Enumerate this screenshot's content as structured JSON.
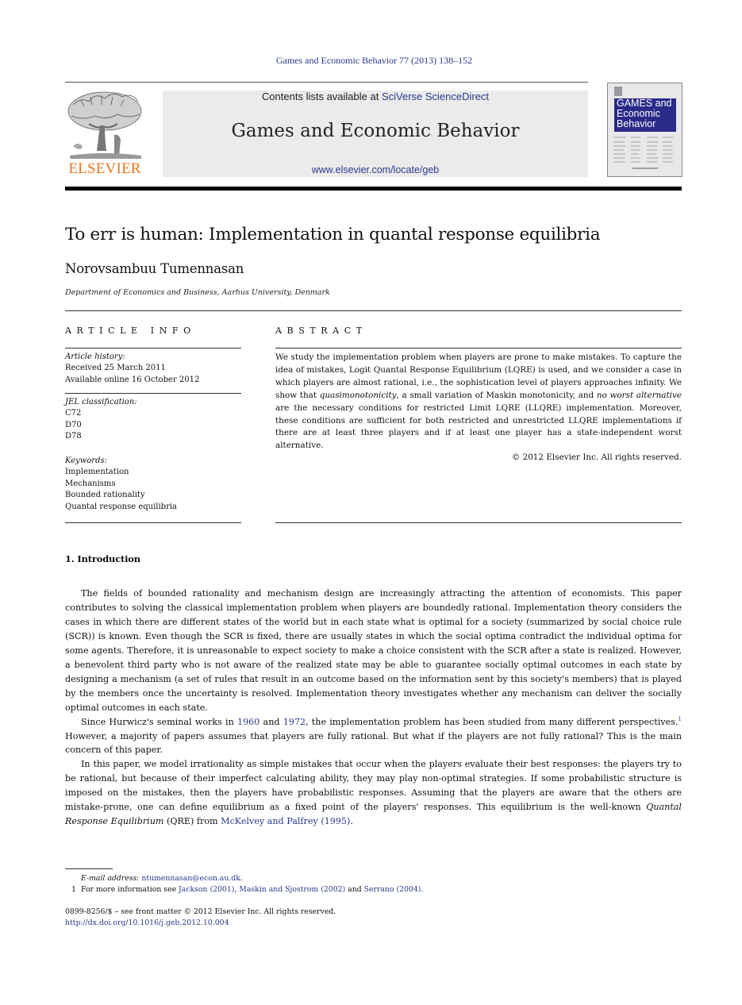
{
  "journal_ref": "Games and Economic Behavior 77 (2013) 138–152",
  "header": {
    "publisher_wordmark": "ELSEVIER",
    "contents_prefix": "Contents lists available at ",
    "contents_link": "SciVerse ScienceDirect",
    "journal_name": "Games and Economic Behavior",
    "journal_url": "www.elsevier.com/locate/geb",
    "cover_title_lines": [
      "GAMES and",
      "Economic",
      "Behavior"
    ],
    "logo_icon": "elsevier-tree-icon",
    "colors": {
      "link": "#2a3a8c",
      "elsevier_orange": "#e87722",
      "cover_blue": "#2a2a8a",
      "header_bg": "#ebebeb"
    }
  },
  "article": {
    "title": "To err is human: Implementation in quantal response equilibria",
    "author": "Norovsambuu Tumennasan",
    "affiliation": "Department of Economics and Business, Aarhus University, Denmark"
  },
  "article_info": {
    "heading": "ARTICLE INFO",
    "history_label": "Article history:",
    "history": [
      "Received 25 March 2011",
      "Available online 16 October 2012"
    ],
    "jel_label": "JEL classification:",
    "jel": [
      "C72",
      "D70",
      "D78"
    ],
    "keywords_label": "Keywords:",
    "keywords": [
      "Implementation",
      "Mechanisms",
      "Bounded rationality",
      "Quantal response equilibria"
    ]
  },
  "abstract": {
    "heading": "ABSTRACT",
    "part1": "We study the implementation problem when players are prone to make mistakes. To capture the idea of mistakes, Logit Quantal Response Equilibrium (LQRE) is used, and we consider a case in which players are almost rational, i.e., the sophistication level of players approaches infinity. We show that ",
    "em1": "quasimonotonicity",
    "part2": ", a small variation of Maskin monotonicity, and ",
    "em2": "no worst alternative",
    "part3": " are the necessary conditions for restricted Limit LQRE (LLQRE) implementation. Moreover, these conditions are sufficient for both restricted and unrestricted LLQRE implementations if there are at least three players and if at least one player has a state-independent worst alternative.",
    "copyright": "© 2012 Elsevier Inc. All rights reserved."
  },
  "section": {
    "heading": "1.  Introduction",
    "p1": "The fields of bounded rationality and mechanism design are increasingly attracting the attention of economists. This paper contributes to solving the classical implementation problem when players are boundedly rational. Implementation theory considers the cases in which there are different states of the world but in each state what is optimal for a society (summarized by social choice rule (SCR)) is known. Even though the SCR is fixed, there are usually states in which the social optima contradict the individual optima for some agents. Therefore, it is unreasonable to expect society to make a choice consistent with the SCR after a state is realized. However, a benevolent third party who is not aware of the realized state may be able to guarantee socially optimal outcomes in each state by designing a mechanism (a set of rules that result in an outcome based on the information sent by this society's members) that is played by the members once the uncertainty is resolved. Implementation theory investigates whether any mechanism can deliver the socially optimal outcomes in each state.",
    "p2_a": "Since Hurwicz's seminal works in ",
    "p2_link1": "1960",
    "p2_b": " and ",
    "p2_link2": "1972",
    "p2_c": ", the implementation problem has been studied from many different perspectives.",
    "p2_fn": "1",
    "p2_d": " However, a majority of papers assumes that players are fully rational. But what if the players are not fully rational? This is the main concern of this paper.",
    "p3_a": "In this paper, we model irrationality as simple mistakes that occur when the players evaluate their best responses: the players try to be rational, but because of their imperfect calculating ability, they may play non-optimal strategies. If some probabilistic structure is imposed on the mistakes, then the players have probabilistic responses. Assuming that the players are aware that the others are mistake-prone, one can define equilibrium as a fixed point of the players' responses. This equilibrium is the well-known ",
    "p3_em": "Quantal Response Equilibrium",
    "p3_b": " (QRE) from ",
    "p3_link": "McKelvey and Palfrey (1995)",
    "p3_c": "."
  },
  "footnotes": {
    "email_label": "E-mail address: ",
    "email": "ntumennasan@econ.au.dk",
    "email_end": ".",
    "fn1_num": "1",
    "fn1_a": "For more information see ",
    "fn1_link1": "Jackson (2001)",
    "fn1_b": ", ",
    "fn1_link2": "Maskin and Sjostrom (2002)",
    "fn1_c": " and ",
    "fn1_link3": "Serrano (2004)",
    "fn1_d": "."
  },
  "front_matter": "0899-8256/$ – see front matter  © 2012 Elsevier Inc. All rights reserved.",
  "doi": "http://dx.doi.org/10.1016/j.geb.2012.10.004"
}
